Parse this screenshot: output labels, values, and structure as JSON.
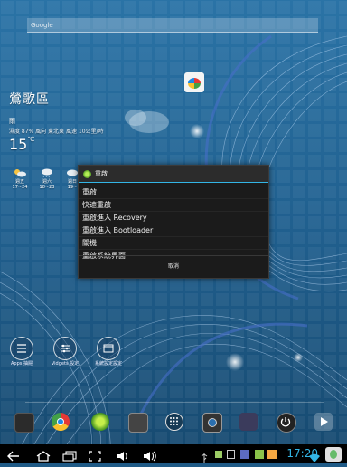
{
  "search": {
    "placeholder": "Google"
  },
  "shortcut": {
    "label": ""
  },
  "weather": {
    "city": "鶯歌區",
    "condition": "雨",
    "details": "濕度 87%  風向 東北東 風速 10公里/時",
    "temperature": "15",
    "unit": "℃",
    "forecast": [
      {
        "day": "週五",
        "range": "17~24",
        "icon": "cloudy-sun-icon"
      },
      {
        "day": "週六",
        "range": "18~23",
        "icon": "rain-cloud-icon"
      },
      {
        "day": "週日",
        "range": "19~",
        "icon": "cloud-icon"
      }
    ]
  },
  "home": {
    "apps_label": "Apps 抽屜",
    "widgets_label": "Vidgets 設定",
    "settings_label": "系統設定設定"
  },
  "dialog": {
    "title": "重啟",
    "options": [
      "重啟",
      "快速重啟",
      "重啟進入 Recovery",
      "重啟進入 Bootloader",
      "關機",
      "重啟系統界面"
    ],
    "cancel": "取消"
  },
  "status": {
    "time": "17:20"
  },
  "colors": {
    "accent": "#33b5e5",
    "dialog_bg": "#1b1b1b",
    "wallpaper": "#1f5a86"
  }
}
